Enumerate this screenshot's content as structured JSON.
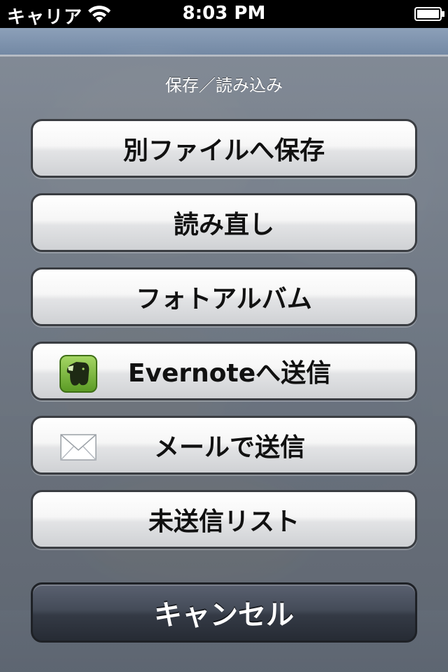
{
  "status_bar": {
    "carrier": "キャリア",
    "time": "8:03 PM",
    "wifi_icon": "wifi-icon",
    "battery_icon": "battery-icon"
  },
  "sheet": {
    "title": "保存／読み込み",
    "buttons": [
      {
        "label": "別ファイルへ保存"
      },
      {
        "label": "読み直し"
      },
      {
        "label": "フォトアルバム"
      },
      {
        "label": "Evernoteへ送信",
        "icon": "evernote-elephant-icon"
      },
      {
        "label": "メールで送信",
        "icon": "mail-envelope-icon"
      },
      {
        "label": "未送信リスト"
      }
    ],
    "cancel_label": "キャンセル"
  },
  "colors": {
    "status_bar_bg": "#000000",
    "sheet_bg": "#6a727e",
    "button_bg": "#f2f2f2",
    "cancel_bg": "#3a404c",
    "evernote_green": "#79b93a"
  }
}
